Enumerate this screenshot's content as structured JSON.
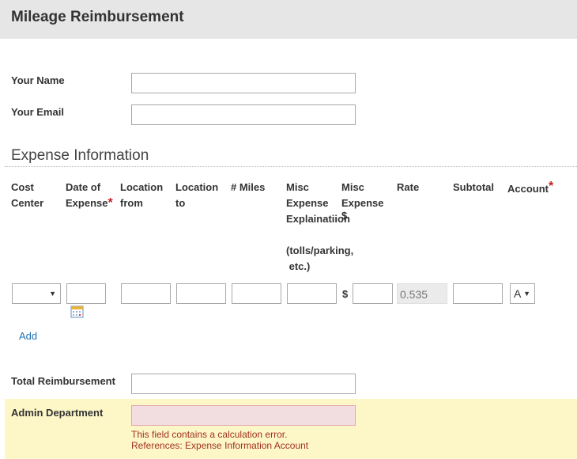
{
  "header": {
    "title": "Mileage Reimbursement"
  },
  "fields": {
    "name_label": "Your Name",
    "email_label": "Your Email",
    "name_value": "",
    "email_value": ""
  },
  "section": {
    "title": "Expense Information"
  },
  "columns": {
    "cost_center": [
      "Cost",
      "Center"
    ],
    "date": [
      "Date of",
      "Expense"
    ],
    "loc_from": [
      "Location",
      "from"
    ],
    "loc_to": [
      "Location",
      "to"
    ],
    "miles": "# Miles",
    "misc_expl": [
      "Misc",
      "Expense",
      "Explainatiion"
    ],
    "misc_expl_note": [
      "(tolls/parking,",
      " etc.)"
    ],
    "misc_amount": [
      "Misc",
      "Expense",
      "$"
    ],
    "rate": "Rate",
    "subtotal": "Subtotal",
    "account": "Account",
    "required_mark": "*"
  },
  "row": {
    "cost_center_value": "",
    "currency_symbol": "$",
    "rate_value": "0.535",
    "account_value": "A"
  },
  "actions": {
    "add_label": "Add"
  },
  "totals": {
    "total_label": "Total Reimbursement",
    "total_value": ""
  },
  "admin": {
    "label": "Admin Department",
    "error_line1": "This field contains a calculation error.",
    "error_line2": "References: Expense Information Account"
  },
  "icons": {
    "arrow": "▼",
    "calendar": "calendar-icon"
  },
  "colors": {
    "header_bg": "#e6e6e6",
    "link": "#1f6fb2",
    "required": "#c02020",
    "error_text": "#a1331f",
    "admin_band": "#fdf6c7",
    "error_field": "#f2dde0"
  }
}
